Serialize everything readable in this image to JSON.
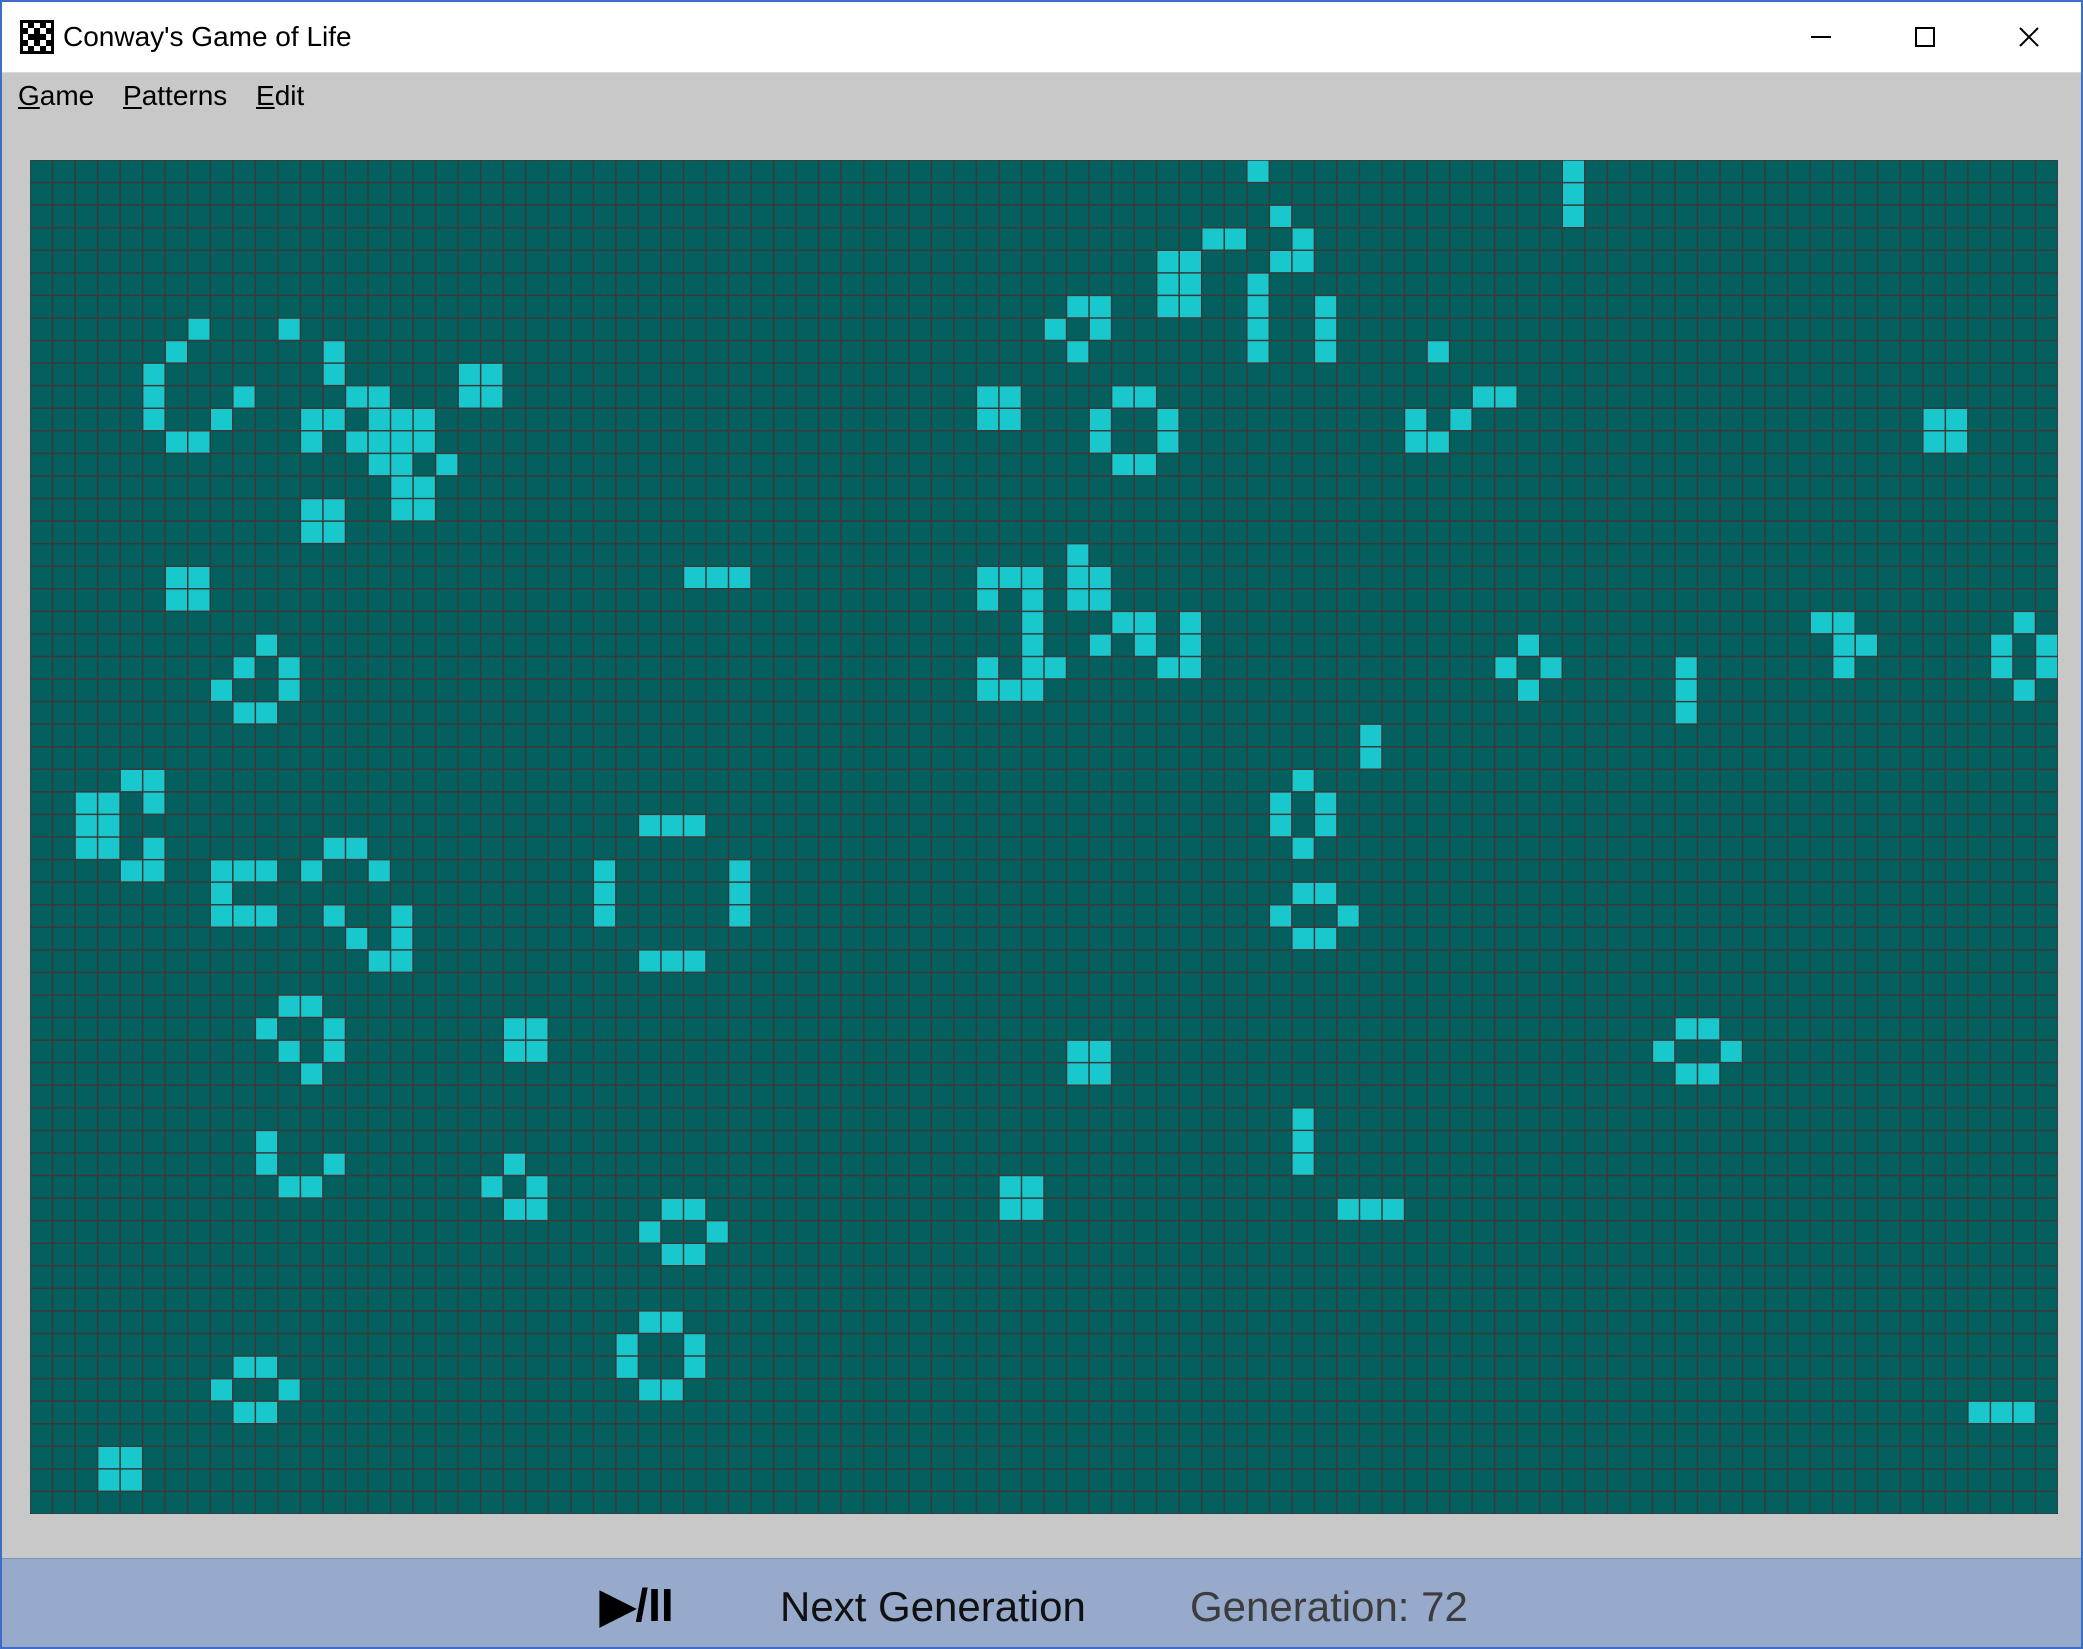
{
  "window": {
    "title": "Conway's Game of Life",
    "app_icon": "game-of-life-logo-icon",
    "controls": [
      "minimize-icon",
      "maximize-icon",
      "close-icon"
    ]
  },
  "menu": {
    "items": [
      {
        "label": "Game",
        "mnemonic": "G",
        "rest": "ame"
      },
      {
        "label": "Patterns",
        "mnemonic": "P",
        "rest": "atterns"
      },
      {
        "label": "Edit",
        "mnemonic": "E",
        "rest": "dit"
      }
    ]
  },
  "board": {
    "columns": 90,
    "rows": 60,
    "dead_color": "#03605e",
    "alive_color": "#18c8cc",
    "grid_line_color": "#3a3a3a",
    "live_cells": [
      [
        0,
        54
      ],
      [
        0,
        68
      ],
      [
        1,
        68
      ],
      [
        2,
        55
      ],
      [
        2,
        68
      ],
      [
        3,
        52
      ],
      [
        3,
        53
      ],
      [
        3,
        56
      ],
      [
        4,
        50
      ],
      [
        4,
        51
      ],
      [
        4,
        55
      ],
      [
        4,
        56
      ],
      [
        5,
        50
      ],
      [
        5,
        51
      ],
      [
        5,
        54
      ],
      [
        6,
        46
      ],
      [
        6,
        47
      ],
      [
        6,
        50
      ],
      [
        6,
        51
      ],
      [
        6,
        54
      ],
      [
        6,
        57
      ],
      [
        7,
        7
      ],
      [
        7,
        11
      ],
      [
        7,
        45
      ],
      [
        7,
        47
      ],
      [
        7,
        54
      ],
      [
        7,
        57
      ],
      [
        8,
        6
      ],
      [
        8,
        13
      ],
      [
        8,
        46
      ],
      [
        8,
        54
      ],
      [
        8,
        57
      ],
      [
        8,
        62
      ],
      [
        9,
        5
      ],
      [
        9,
        13
      ],
      [
        9,
        19
      ],
      [
        9,
        20
      ],
      [
        10,
        5
      ],
      [
        10,
        9
      ],
      [
        10,
        14
      ],
      [
        10,
        15
      ],
      [
        10,
        19
      ],
      [
        10,
        20
      ],
      [
        10,
        42
      ],
      [
        10,
        43
      ],
      [
        10,
        48
      ],
      [
        10,
        49
      ],
      [
        10,
        64
      ],
      [
        10,
        65
      ],
      [
        11,
        5
      ],
      [
        11,
        8
      ],
      [
        11,
        12
      ],
      [
        11,
        13
      ],
      [
        11,
        15
      ],
      [
        11,
        16
      ],
      [
        11,
        17
      ],
      [
        11,
        42
      ],
      [
        11,
        43
      ],
      [
        11,
        47
      ],
      [
        11,
        50
      ],
      [
        11,
        61
      ],
      [
        11,
        63
      ],
      [
        11,
        84
      ],
      [
        11,
        85
      ],
      [
        12,
        6
      ],
      [
        12,
        7
      ],
      [
        12,
        12
      ],
      [
        12,
        14
      ],
      [
        12,
        15
      ],
      [
        12,
        16
      ],
      [
        12,
        17
      ],
      [
        12,
        47
      ],
      [
        12,
        50
      ],
      [
        12,
        61
      ],
      [
        12,
        62
      ],
      [
        12,
        84
      ],
      [
        12,
        85
      ],
      [
        13,
        15
      ],
      [
        13,
        16
      ],
      [
        13,
        18
      ],
      [
        13,
        48
      ],
      [
        13,
        49
      ],
      [
        14,
        16
      ],
      [
        14,
        17
      ],
      [
        15,
        12
      ],
      [
        15,
        13
      ],
      [
        15,
        16
      ],
      [
        15,
        17
      ],
      [
        16,
        12
      ],
      [
        16,
        13
      ],
      [
        17,
        46
      ],
      [
        18,
        6
      ],
      [
        18,
        7
      ],
      [
        18,
        29
      ],
      [
        18,
        30
      ],
      [
        18,
        31
      ],
      [
        18,
        42
      ],
      [
        18,
        43
      ],
      [
        18,
        44
      ],
      [
        18,
        46
      ],
      [
        18,
        47
      ],
      [
        19,
        6
      ],
      [
        19,
        7
      ],
      [
        19,
        42
      ],
      [
        19,
        44
      ],
      [
        19,
        46
      ],
      [
        19,
        47
      ],
      [
        20,
        44
      ],
      [
        20,
        48
      ],
      [
        20,
        49
      ],
      [
        20,
        51
      ],
      [
        20,
        79
      ],
      [
        20,
        80
      ],
      [
        20,
        88
      ],
      [
        21,
        10
      ],
      [
        21,
        44
      ],
      [
        21,
        47
      ],
      [
        21,
        49
      ],
      [
        21,
        51
      ],
      [
        21,
        66
      ],
      [
        21,
        80
      ],
      [
        21,
        81
      ],
      [
        21,
        87
      ],
      [
        21,
        89
      ],
      [
        22,
        9
      ],
      [
        22,
        11
      ],
      [
        22,
        42
      ],
      [
        22,
        44
      ],
      [
        22,
        45
      ],
      [
        22,
        50
      ],
      [
        22,
        51
      ],
      [
        22,
        65
      ],
      [
        22,
        67
      ],
      [
        22,
        73
      ],
      [
        22,
        80
      ],
      [
        22,
        87
      ],
      [
        22,
        89
      ],
      [
        23,
        8
      ],
      [
        23,
        11
      ],
      [
        23,
        42
      ],
      [
        23,
        43
      ],
      [
        23,
        44
      ],
      [
        23,
        66
      ],
      [
        23,
        73
      ],
      [
        23,
        88
      ],
      [
        24,
        9
      ],
      [
        24,
        10
      ],
      [
        24,
        73
      ],
      [
        25,
        59
      ],
      [
        26,
        59
      ],
      [
        27,
        4
      ],
      [
        27,
        5
      ],
      [
        27,
        56
      ],
      [
        28,
        2
      ],
      [
        28,
        3
      ],
      [
        28,
        5
      ],
      [
        28,
        55
      ],
      [
        28,
        57
      ],
      [
        29,
        2
      ],
      [
        29,
        3
      ],
      [
        29,
        27
      ],
      [
        29,
        28
      ],
      [
        29,
        29
      ],
      [
        29,
        55
      ],
      [
        29,
        57
      ],
      [
        30,
        2
      ],
      [
        30,
        3
      ],
      [
        30,
        5
      ],
      [
        30,
        13
      ],
      [
        30,
        14
      ],
      [
        30,
        56
      ],
      [
        31,
        4
      ],
      [
        31,
        5
      ],
      [
        31,
        8
      ],
      [
        31,
        9
      ],
      [
        31,
        10
      ],
      [
        31,
        12
      ],
      [
        31,
        15
      ],
      [
        31,
        25
      ],
      [
        31,
        31
      ],
      [
        32,
        8
      ],
      [
        32,
        25
      ],
      [
        32,
        31
      ],
      [
        32,
        56
      ],
      [
        32,
        57
      ],
      [
        33,
        8
      ],
      [
        33,
        9
      ],
      [
        33,
        10
      ],
      [
        33,
        13
      ],
      [
        33,
        16
      ],
      [
        33,
        25
      ],
      [
        33,
        31
      ],
      [
        33,
        55
      ],
      [
        33,
        58
      ],
      [
        34,
        14
      ],
      [
        34,
        16
      ],
      [
        34,
        56
      ],
      [
        34,
        57
      ],
      [
        35,
        15
      ],
      [
        35,
        16
      ],
      [
        35,
        27
      ],
      [
        35,
        28
      ],
      [
        35,
        29
      ],
      [
        37,
        11
      ],
      [
        37,
        12
      ],
      [
        38,
        10
      ],
      [
        38,
        13
      ],
      [
        38,
        21
      ],
      [
        38,
        22
      ],
      [
        38,
        73
      ],
      [
        38,
        74
      ],
      [
        39,
        11
      ],
      [
        39,
        13
      ],
      [
        39,
        21
      ],
      [
        39,
        22
      ],
      [
        39,
        46
      ],
      [
        39,
        47
      ],
      [
        39,
        72
      ],
      [
        39,
        75
      ],
      [
        40,
        12
      ],
      [
        40,
        46
      ],
      [
        40,
        47
      ],
      [
        40,
        73
      ],
      [
        40,
        74
      ],
      [
        42,
        56
      ],
      [
        43,
        10
      ],
      [
        43,
        56
      ],
      [
        44,
        10
      ],
      [
        44,
        13
      ],
      [
        44,
        21
      ],
      [
        44,
        56
      ],
      [
        45,
        11
      ],
      [
        45,
        12
      ],
      [
        45,
        20
      ],
      [
        45,
        22
      ],
      [
        45,
        43
      ],
      [
        45,
        44
      ],
      [
        46,
        21
      ],
      [
        46,
        22
      ],
      [
        46,
        28
      ],
      [
        46,
        29
      ],
      [
        46,
        43
      ],
      [
        46,
        44
      ],
      [
        46,
        58
      ],
      [
        46,
        59
      ],
      [
        46,
        60
      ],
      [
        47,
        27
      ],
      [
        47,
        30
      ],
      [
        48,
        28
      ],
      [
        48,
        29
      ],
      [
        51,
        27
      ],
      [
        51,
        28
      ],
      [
        52,
        26
      ],
      [
        52,
        29
      ],
      [
        53,
        9
      ],
      [
        53,
        10
      ],
      [
        53,
        26
      ],
      [
        53,
        29
      ],
      [
        54,
        8
      ],
      [
        54,
        11
      ],
      [
        54,
        27
      ],
      [
        54,
        28
      ],
      [
        55,
        9
      ],
      [
        55,
        10
      ],
      [
        55,
        86
      ],
      [
        55,
        87
      ],
      [
        55,
        88
      ],
      [
        57,
        3
      ],
      [
        57,
        4
      ],
      [
        58,
        3
      ],
      [
        58,
        4
      ]
    ]
  },
  "status": {
    "play_pause_label": "▶/II",
    "next_generation_label": "Next Generation",
    "generation_label": "Generation: 72",
    "generation": 72
  }
}
